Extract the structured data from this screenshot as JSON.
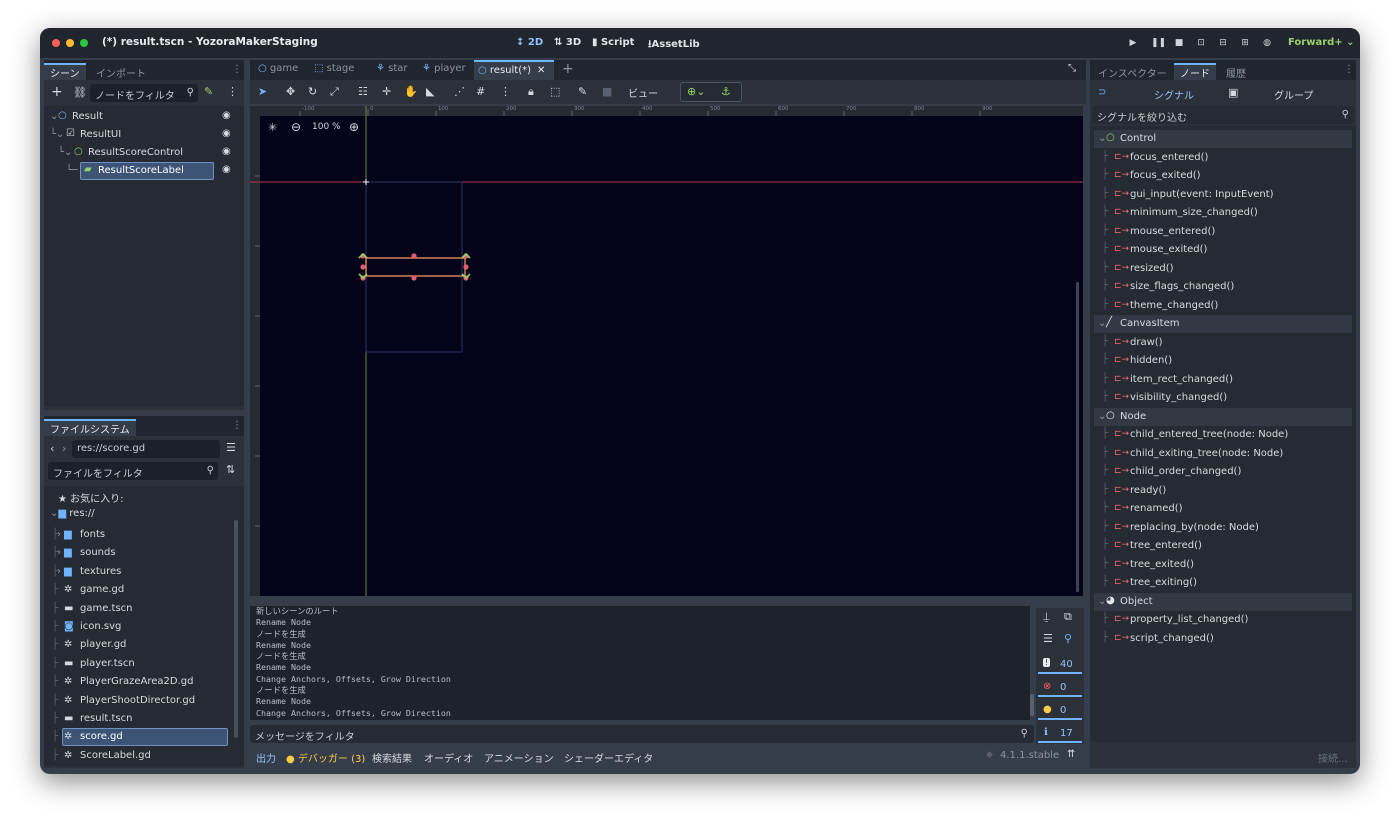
{
  "window": {
    "title": "(*) result.tscn - YozoraMakerStaging"
  },
  "modes": [
    {
      "label": "2D",
      "active": true
    },
    {
      "label": "3D",
      "active": false
    },
    {
      "label": "Script",
      "active": false
    },
    {
      "label": "AssetLib",
      "active": false
    }
  ],
  "renderer": "Forward+ ⌄",
  "scene_dock": {
    "tabs": [
      "シーン",
      "インポート"
    ],
    "filter_placeholder": "ノードをフィルタ",
    "tree": [
      {
        "label": "Result",
        "selected": false
      },
      {
        "label": "ResultUI",
        "selected": false
      },
      {
        "label": "ResultScoreControl",
        "selected": false
      },
      {
        "label": "ResultScoreLabel",
        "selected": true
      }
    ]
  },
  "filesystem": {
    "tab": "ファイルシステム",
    "path": "res://score.gd",
    "filter_placeholder": "ファイルをフィルタ",
    "favorites": "お気に入り:",
    "root": "res://",
    "items": [
      {
        "label": "fonts",
        "kind": "folder"
      },
      {
        "label": "sounds",
        "kind": "folder"
      },
      {
        "label": "textures",
        "kind": "folder"
      },
      {
        "label": "game.gd",
        "kind": "script"
      },
      {
        "label": "game.tscn",
        "kind": "scene"
      },
      {
        "label": "icon.svg",
        "kind": "image"
      },
      {
        "label": "player.gd",
        "kind": "script"
      },
      {
        "label": "player.tscn",
        "kind": "scene"
      },
      {
        "label": "PlayerGrazeArea2D.gd",
        "kind": "script"
      },
      {
        "label": "PlayerShootDirector.gd",
        "kind": "script"
      },
      {
        "label": "result.tscn",
        "kind": "scene"
      },
      {
        "label": "score.gd",
        "kind": "script",
        "selected": true
      },
      {
        "label": "ScoreLabel.gd",
        "kind": "script"
      }
    ]
  },
  "editor_tabs": [
    {
      "label": "game",
      "active": false
    },
    {
      "label": "stage",
      "active": false
    },
    {
      "label": "star",
      "active": false
    },
    {
      "label": "player",
      "active": false
    },
    {
      "label": "result(*)",
      "active": true
    }
  ],
  "toolbar": {
    "view_label": "ビュー"
  },
  "viewport": {
    "zoom": "100 %",
    "ruler_ticks": [
      "-100",
      "0",
      "100",
      "200",
      "300",
      "400",
      "500",
      "600",
      "700",
      "800",
      "900"
    ]
  },
  "output": {
    "lines": [
      "新しいシーンのルート",
      "Rename Node",
      "ノードを生成",
      "Rename Node",
      "ノードを生成",
      "Rename Node",
      "Change Anchors, Offsets, Grow Direction",
      "ノードを生成",
      "Rename Node",
      "Change Anchors, Offsets, Grow Direction"
    ],
    "filter_placeholder": "メッセージをフィルタ",
    "counts": {
      "messages": "40",
      "errors": "0",
      "warnings": "0",
      "editor": "17"
    }
  },
  "bottom_tabs": [
    {
      "label": "出力",
      "active": true
    },
    {
      "label": "● デバッガー (3)",
      "active": false
    },
    {
      "label": "検索結果",
      "active": false
    },
    {
      "label": "オーディオ",
      "active": false
    },
    {
      "label": "アニメーション",
      "active": false
    },
    {
      "label": "シェーダーエディタ",
      "active": false
    }
  ],
  "version": "4.1.1.stable",
  "right_dock": {
    "tabs": [
      "インスペクター",
      "ノード",
      "履歴"
    ],
    "subtabs": [
      "シグナル",
      "グループ"
    ],
    "filter_placeholder": "シグナルを絞り込む",
    "categories": [
      {
        "name": "Control",
        "signals": [
          "focus_entered()",
          "focus_exited()",
          "gui_input(event: InputEvent)",
          "minimum_size_changed()",
          "mouse_entered()",
          "mouse_exited()",
          "resized()",
          "size_flags_changed()",
          "theme_changed()"
        ]
      },
      {
        "name": "CanvasItem",
        "signals": [
          "draw()",
          "hidden()",
          "item_rect_changed()",
          "visibility_changed()"
        ]
      },
      {
        "name": "Node",
        "signals": [
          "child_entered_tree(node: Node)",
          "child_exiting_tree(node: Node)",
          "child_order_changed()",
          "ready()",
          "renamed()",
          "replacing_by(node: Node)",
          "tree_entered()",
          "tree_exited()",
          "tree_exiting()"
        ]
      },
      {
        "name": "Object",
        "signals": [
          "property_list_changed()",
          "script_changed()"
        ]
      }
    ],
    "connect_button": "接続..."
  }
}
